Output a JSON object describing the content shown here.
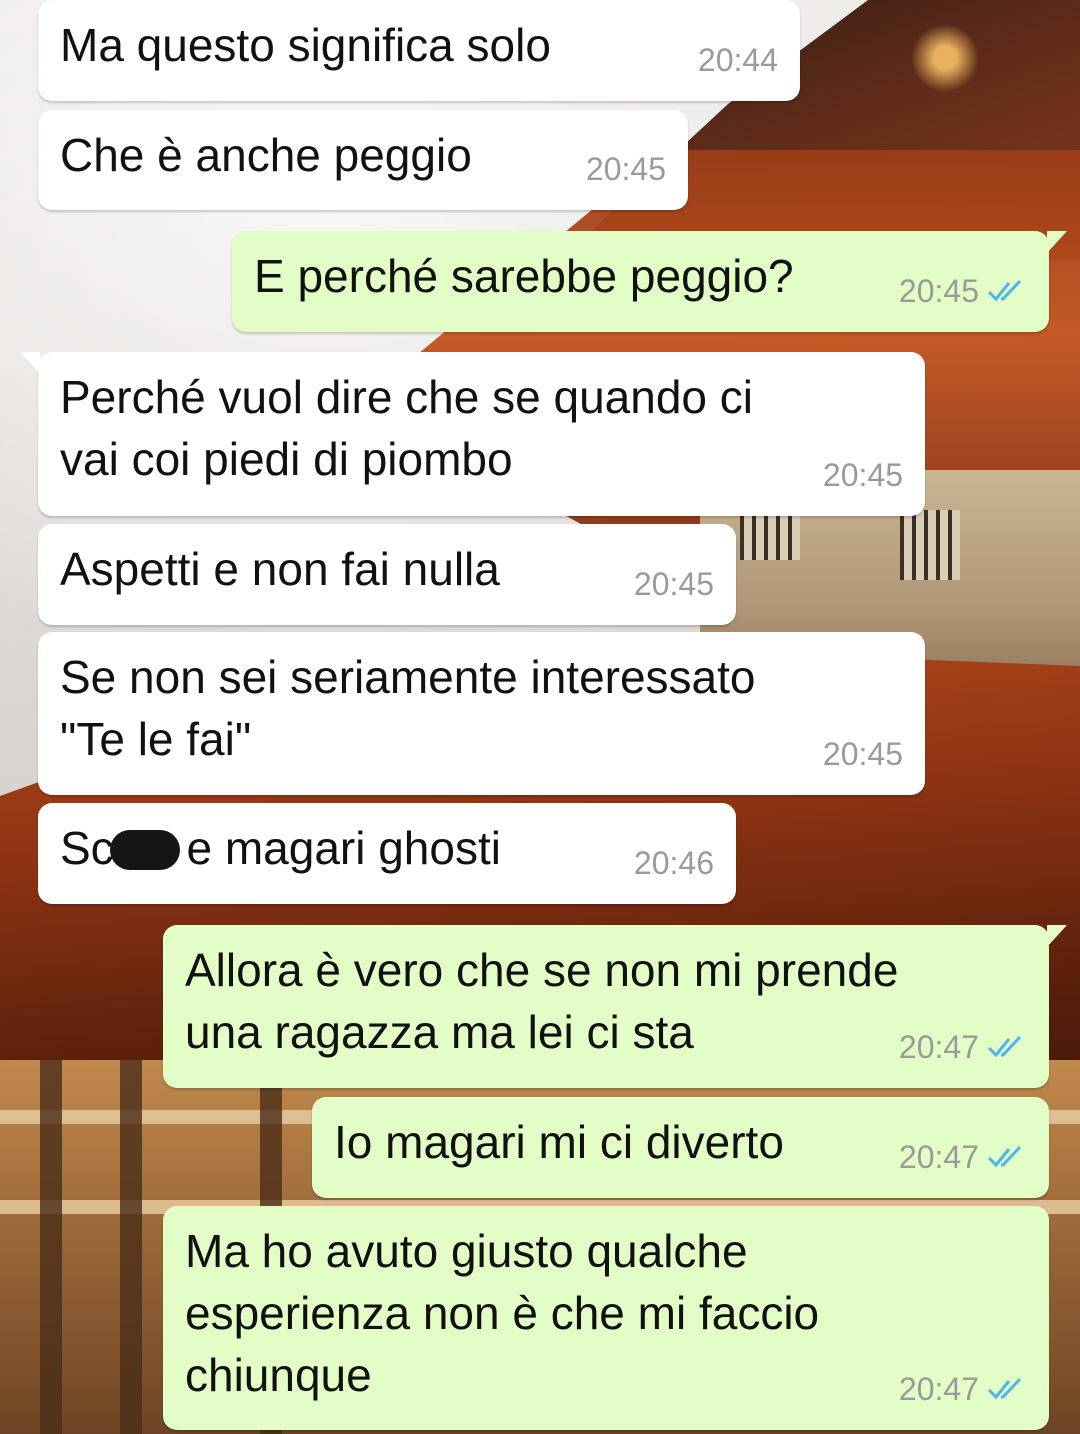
{
  "messages": [
    {
      "direction": "in",
      "text": "Ma questo significa solo",
      "time": "20:44"
    },
    {
      "direction": "in",
      "text": "Che è anche peggio",
      "time": "20:45"
    },
    {
      "direction": "out",
      "text": "E perché sarebbe peggio?",
      "time": "20:45",
      "status": "read"
    },
    {
      "direction": "in",
      "text": "Perché vuol dire che se quando ci\nvai coi piedi di piombo",
      "time": "20:45"
    },
    {
      "direction": "in",
      "text": "Aspetti e non fai nulla",
      "time": "20:45"
    },
    {
      "direction": "in",
      "text": "Se non sei seriamente interessato\n\"Te le fai\"",
      "time": "20:45"
    },
    {
      "direction": "in",
      "text_before": "Sc",
      "text_after": " e magari ghosti",
      "time": "20:46",
      "redacted": true
    },
    {
      "direction": "out",
      "text": "Allora è vero che se non mi prende\nuna ragazza ma lei ci sta",
      "time": "20:47",
      "status": "read"
    },
    {
      "direction": "out",
      "text": "Io magari mi ci diverto",
      "time": "20:47",
      "status": "read"
    },
    {
      "direction": "out",
      "text": "Ma ho avuto giusto qualche\nesperienza non è che mi faccio\nchiunque",
      "time": "20:47",
      "status": "read"
    }
  ],
  "colors": {
    "incoming_bubble": "#ffffff",
    "outgoing_bubble": "#e2fdc6",
    "read_ticks": "#4fb6ec",
    "timestamp": "#9a9a9a"
  },
  "icons": {
    "read_status": "double-check-icon"
  }
}
